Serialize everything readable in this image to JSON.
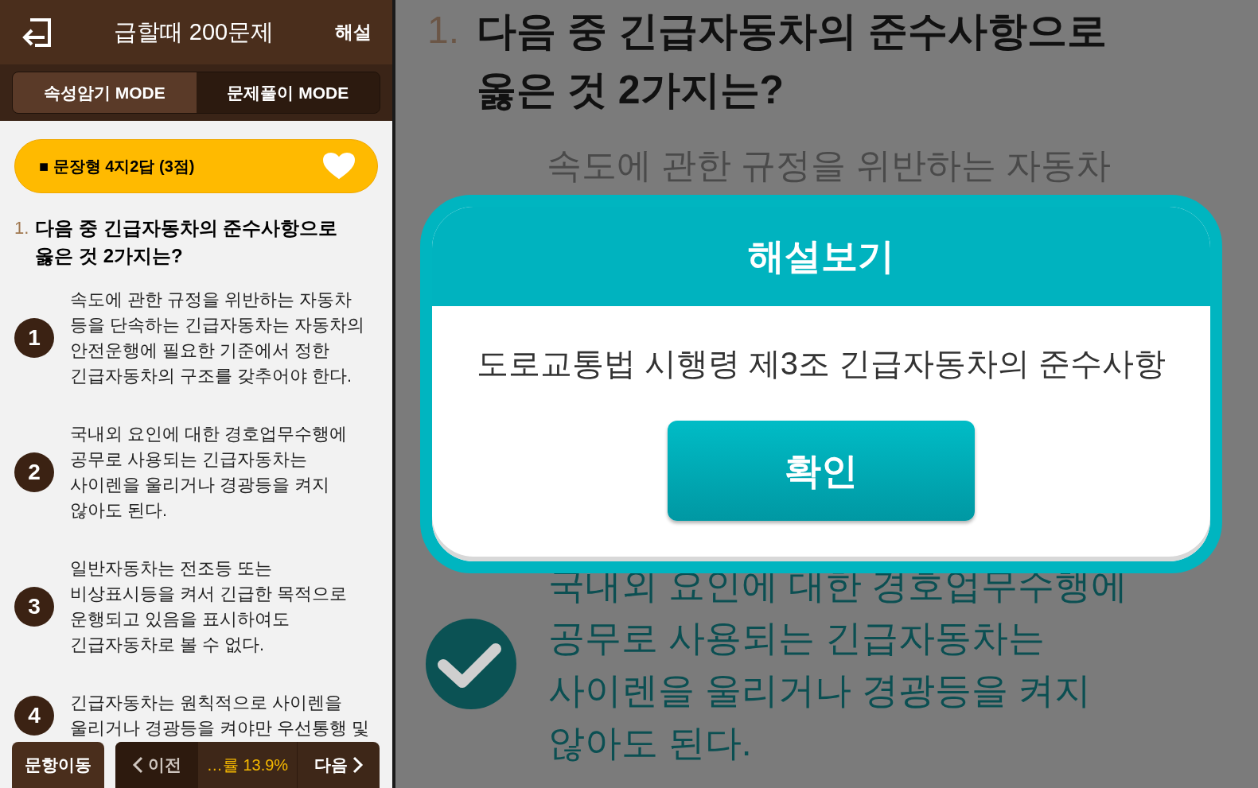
{
  "left": {
    "header": {
      "title": "급할때 200문제",
      "action": "해설"
    },
    "tabs": [
      {
        "label": "속성암기 MODE",
        "selected": true
      },
      {
        "label": "문제풀이 MODE",
        "selected": false
      }
    ],
    "question_type": {
      "label": "■ 문장형 4지2답 (3점)",
      "favorite": true
    },
    "question": {
      "number": "1.",
      "text": "다음 중 긴급자동차의 준수사항으로 옳은 것 2가지는?"
    },
    "choices": [
      {
        "number": "1",
        "lines": [
          "속도에 관한 규정을 위반하는 자동차",
          "등을 단속하는 긴급자동차는 자동차의",
          "안전운행에 필요한 기준에서 정한",
          "긴급자동차의 구조를 갖추어야 한다."
        ]
      },
      {
        "number": "2",
        "lines": [
          "국내외 요인에 대한 경호업무수행에",
          "공무로 사용되는 긴급자동차는",
          "사이렌을 울리거나 경광등을 켜지",
          "않아도 된다."
        ]
      },
      {
        "number": "3",
        "lines": [
          "일반자동차는 전조등 또는",
          "비상표시등을 켜서 긴급한 목적으로",
          "운행되고 있음을 표시하여도",
          "긴급자동차로 볼 수 없다."
        ]
      },
      {
        "number": "4",
        "lines": [
          "긴급자동차는 원칙적으로 사이렌을",
          "울리거나 경광등을 켜야만 우선통행 및"
        ]
      }
    ],
    "bottom_bar": {
      "jump": "문항이동",
      "prev": "이전",
      "rate": "…률 13.9%",
      "next": "다음"
    }
  },
  "right": {
    "question": {
      "number": "1.",
      "lines": [
        "다음 중 긴급자동차의 준수사항으로",
        "옳은 것 2가지는?"
      ]
    },
    "choice_above": "속도에 관한 규정을 위반하는 자동차",
    "answer": {
      "checked": true,
      "lines": [
        "국내외 요인에 대한 경호업무수행에",
        "공무로 사용되는 긴급자동차는",
        "사이렌을 울리거나 경광등을 켜지",
        "않아도 된다."
      ]
    },
    "dialog": {
      "title": "해설보기",
      "text": "도로교통법 시행령 제3조 긴급자동차의 준수사항",
      "button": "확인"
    }
  }
}
